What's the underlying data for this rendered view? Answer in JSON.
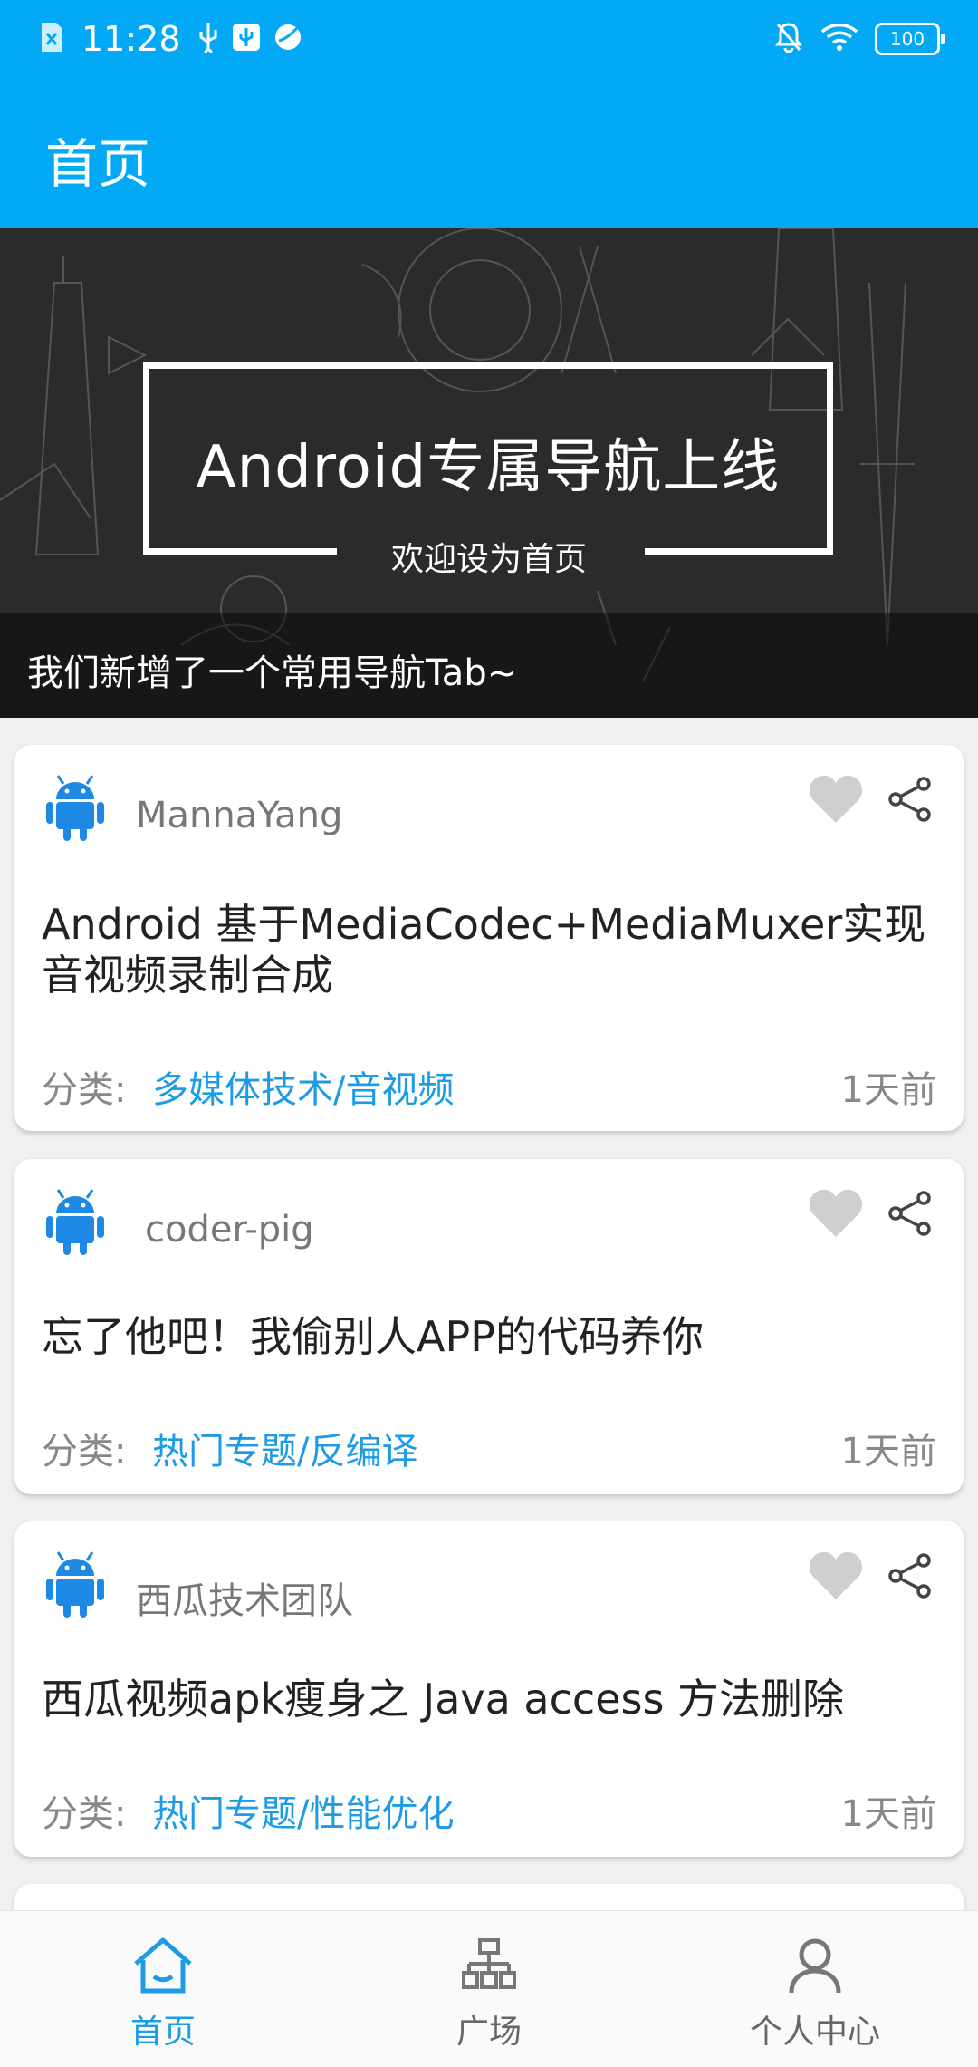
{
  "status_bar": {
    "time": "11:28",
    "battery": "100"
  },
  "header": {
    "title": "首页"
  },
  "banner": {
    "title": "Android专属导航上线",
    "subtitle": "欢迎设为首页",
    "caption": "我们新增了一个常用导航Tab~"
  },
  "labels": {
    "category": "分类:"
  },
  "articles": [
    {
      "author": "MannaYang",
      "title": "Android 基于MediaCodec+MediaMuxer实现\n音视频录制合成",
      "category": "多媒体技术/音视频",
      "time": "1天前"
    },
    {
      "author": "coder-pig",
      "title": "忘了他吧！我偷别人APP的代码养你",
      "category": "热门专题/反编译",
      "time": "1天前"
    },
    {
      "author": "西瓜技术团队",
      "title": "西瓜视频apk瘦身之 Java access 方法删除",
      "category": "热门专题/性能优化",
      "time": "1天前"
    }
  ],
  "bottom_nav": [
    {
      "label": "首页",
      "icon": "home-icon",
      "active": true
    },
    {
      "label": "广场",
      "icon": "square-icon",
      "active": false
    },
    {
      "label": "个人中心",
      "icon": "profile-icon",
      "active": false
    }
  ],
  "colors": {
    "primary": "#03A9F4",
    "accent": "#1E9BE5",
    "android": "#1E88E5"
  }
}
